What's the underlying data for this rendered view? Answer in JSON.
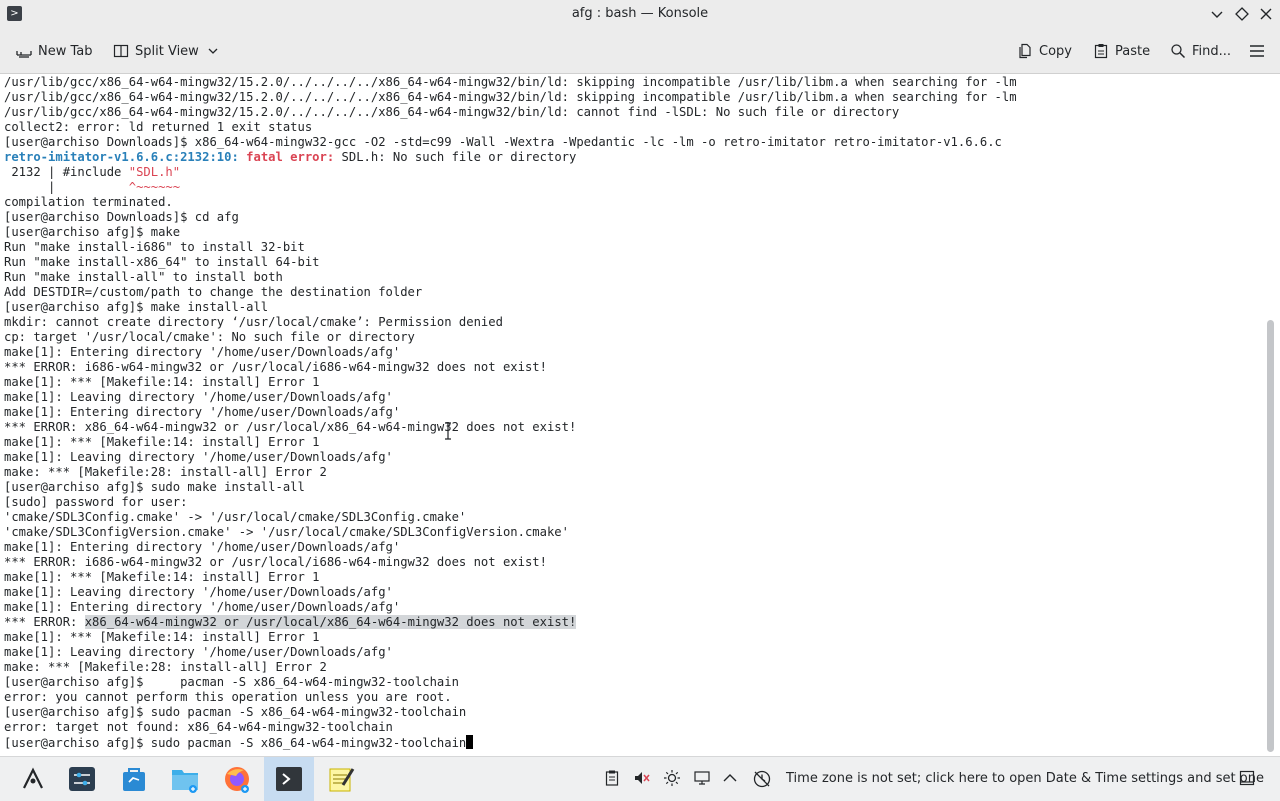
{
  "window": {
    "title": "afg : bash — Konsole"
  },
  "toolbar": {
    "new_tab": "New Tab",
    "split_view": "Split View",
    "copy": "Copy",
    "paste": "Paste",
    "find": "Find..."
  },
  "terminal": {
    "lines": [
      [
        {
          "t": "/usr/lib/gcc/x86_64-w64-mingw32/15.2.0/../../../../x86_64-w64-mingw32/bin/ld: skipping incompatible /usr/lib/libm.a when searching for -lm"
        }
      ],
      [
        {
          "t": "/usr/lib/gcc/x86_64-w64-mingw32/15.2.0/../../../../x86_64-w64-mingw32/bin/ld: skipping incompatible /usr/lib/libm.a when searching for -lm"
        }
      ],
      [
        {
          "t": "/usr/lib/gcc/x86_64-w64-mingw32/15.2.0/../../../../x86_64-w64-mingw32/bin/ld: cannot find -lSDL: No such file or directory"
        }
      ],
      [
        {
          "t": "collect2: error: ld returned 1 exit status"
        }
      ],
      [
        {
          "t": "[user@archiso Downloads]$ x86_64-w64-mingw32-gcc -O2 -std=c99 -Wall -Wextra -Wpedantic -lc -lm -o retro-imitator retro-imitator-v1.6.6.c"
        }
      ],
      [
        {
          "t": "retro-imitator-v1.6.6.c:2132:10: ",
          "c": "blue"
        },
        {
          "t": "fatal error: ",
          "c": "red"
        },
        {
          "t": "SDL.h: No such file or directory"
        }
      ],
      [
        {
          "t": " 2132 | #include "
        },
        {
          "t": "\"SDL.h\"",
          "c": "redt"
        }
      ],
      [
        {
          "t": "      |          "
        },
        {
          "t": "^~~~~~~",
          "c": "redt"
        }
      ],
      [
        {
          "t": "compilation terminated."
        }
      ],
      [
        {
          "t": "[user@archiso Downloads]$ cd afg"
        }
      ],
      [
        {
          "t": "[user@archiso afg]$ make"
        }
      ],
      [
        {
          "t": "Run \"make install-i686\" to install 32-bit"
        }
      ],
      [
        {
          "t": "Run \"make install-x86_64\" to install 64-bit"
        }
      ],
      [
        {
          "t": "Run \"make install-all\" to install both"
        }
      ],
      [
        {
          "t": "Add DESTDIR=/custom/path to change the destination folder"
        }
      ],
      [
        {
          "t": "[user@archiso afg]$ make install-all"
        }
      ],
      [
        {
          "t": "mkdir: cannot create directory ‘/usr/local/cmake’: Permission denied"
        }
      ],
      [
        {
          "t": "cp: target '/usr/local/cmake': No such file or directory"
        }
      ],
      [
        {
          "t": "make[1]: Entering directory '/home/user/Downloads/afg'"
        }
      ],
      [
        {
          "t": "*** ERROR: i686-w64-mingw32 or /usr/local/i686-w64-mingw32 does not exist!"
        }
      ],
      [
        {
          "t": "make[1]: *** [Makefile:14: install] Error 1"
        }
      ],
      [
        {
          "t": "make[1]: Leaving directory '/home/user/Downloads/afg'"
        }
      ],
      [
        {
          "t": "make[1]: Entering directory '/home/user/Downloads/afg'"
        }
      ],
      [
        {
          "t": "*** ERROR: x86_64-w64-mingw32 or /usr/local/x86_64-w64-mingw32 does not exist!"
        }
      ],
      [
        {
          "t": "make[1]: *** [Makefile:14: install] Error 1"
        }
      ],
      [
        {
          "t": "make[1]: Leaving directory '/home/user/Downloads/afg'"
        }
      ],
      [
        {
          "t": "make: *** [Makefile:28: install-all] Error 2"
        }
      ],
      [
        {
          "t": "[user@archiso afg]$ sudo make install-all"
        }
      ],
      [
        {
          "t": "[sudo] password for user:"
        }
      ],
      [
        {
          "t": "'cmake/SDL3Config.cmake' -> '/usr/local/cmake/SDL3Config.cmake'"
        }
      ],
      [
        {
          "t": "'cmake/SDL3ConfigVersion.cmake' -> '/usr/local/cmake/SDL3ConfigVersion.cmake'"
        }
      ],
      [
        {
          "t": "make[1]: Entering directory '/home/user/Downloads/afg'"
        }
      ],
      [
        {
          "t": "*** ERROR: i686-w64-mingw32 or /usr/local/i686-w64-mingw32 does not exist!"
        }
      ],
      [
        {
          "t": "make[1]: *** [Makefile:14: install] Error 1"
        }
      ],
      [
        {
          "t": "make[1]: Leaving directory '/home/user/Downloads/afg'"
        }
      ],
      [
        {
          "t": "make[1]: Entering directory '/home/user/Downloads/afg'"
        }
      ],
      [
        {
          "t": "*** ERROR: "
        },
        {
          "t": "x86_64-w64-mingw32 or /usr/local/x86_64-w64-mingw32 does not exist!",
          "c": "sel"
        }
      ],
      [
        {
          "t": "make[1]: *** [Makefile:14: install] Error 1"
        }
      ],
      [
        {
          "t": "make[1]: Leaving directory '/home/user/Downloads/afg'"
        }
      ],
      [
        {
          "t": "make: *** [Makefile:28: install-all] Error 2"
        }
      ],
      [
        {
          "t": "[user@archiso afg]$     pacman -S x86_64-w64-mingw32-toolchain"
        }
      ],
      [
        {
          "t": "error: you cannot perform this operation unless you are root."
        }
      ],
      [
        {
          "t": "[user@archiso afg]$ sudo pacman -S x86_64-w64-mingw32-toolchain"
        }
      ],
      [
        {
          "t": "error: target not found: x86_64-w64-mingw32-toolchain"
        }
      ],
      [
        {
          "t": "[user@archiso afg]$ sudo pacman -S x86_64-w64-mingw32-toolchain"
        },
        {
          "cursor": true
        }
      ]
    ]
  },
  "taskbar": {
    "timezone_notice": "Time zone is not set; click here to open Date & Time settings and set one"
  },
  "colors": {
    "accent": "#3daee9",
    "error_red": "#da4453",
    "path_blue": "#2980b9",
    "selection": "#d3d6d9"
  }
}
